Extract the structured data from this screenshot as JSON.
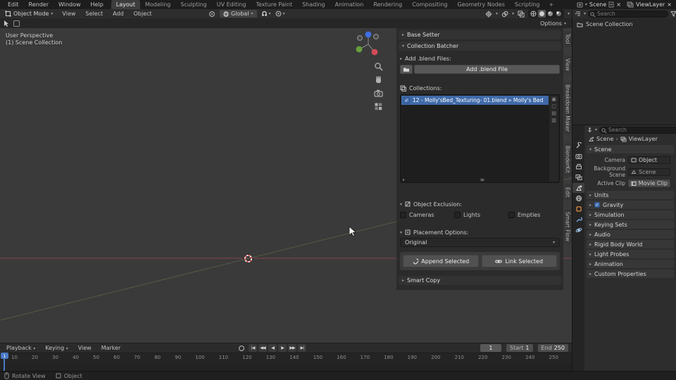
{
  "topbar": {
    "menus": [
      "Edit",
      "Render",
      "Window",
      "Help"
    ],
    "tabs": [
      "Layout",
      "Modeling",
      "Sculpting",
      "UV Editing",
      "Texture Paint",
      "Shading",
      "Animation",
      "Rendering",
      "Compositing",
      "Geometry Nodes",
      "Scripting"
    ],
    "add_tab": "+",
    "scene": "Scene",
    "viewlayer": "ViewLayer"
  },
  "header": {
    "mode": "Object Mode",
    "menus": [
      "View",
      "Select",
      "Add",
      "Object"
    ],
    "orientation": "Global",
    "options": "Options"
  },
  "viewport": {
    "perspective_label": "User Perspective",
    "collection_label": "(1) Scene Collection"
  },
  "sidebar_tabs": [
    "Tool",
    "View",
    "Breakdown Maker",
    "BlenderKit",
    "Edit",
    "Smart Flow"
  ],
  "npanel": {
    "base_setter": "Base Setter",
    "collection_batcher": "Collection Batcher",
    "add_blend_files_label": "Add .blend Files:",
    "add_blend_file_button": "Add .blend File",
    "collections_label": "Collections:",
    "collection_item": "12 - Molly'sBed_Texturing- 01.blend » Molly's Bed",
    "object_exclusion_label": "Object Exclusion:",
    "exclusion_options": [
      "Cameras",
      "Lights",
      "Empties"
    ],
    "placement_label": "Placement Options:",
    "placement_value": "Original",
    "append_button": "Append Selected",
    "link_button": "Link Selected",
    "smart_copy": "Smart Copy"
  },
  "outliner": {
    "search_placeholder": "Search",
    "root_item": "Scene Collection"
  },
  "properties": {
    "search_placeholder": "Search",
    "breadcrumb": {
      "scene": "Scene",
      "viewlayer": "ViewLayer"
    },
    "scene_section": "Scene",
    "fields": [
      {
        "label": "Camera",
        "value": "Object"
      },
      {
        "label": "Background Scene",
        "value": "Scene"
      },
      {
        "label": "Active Clip",
        "value": "Movie Clip"
      }
    ],
    "sections": [
      "Units",
      "Gravity",
      "Simulation",
      "Keying Sets",
      "Audio",
      "Rigid Body World",
      "Light Probes",
      "Animation",
      "Custom Properties"
    ]
  },
  "timeline": {
    "menus": [
      "Playback",
      "Keying",
      "View",
      "Marker"
    ],
    "current_frame": "1",
    "start_label": "Start",
    "start_value": "1",
    "end_label": "End",
    "end_value": "250",
    "ticks": [
      "10",
      "20",
      "30",
      "40",
      "50",
      "60",
      "70",
      "80",
      "90",
      "100",
      "110",
      "120",
      "130",
      "140",
      "150",
      "160",
      "170",
      "180",
      "190",
      "200",
      "210",
      "220",
      "230",
      "240",
      "250"
    ]
  },
  "statusbar": {
    "left": "Rotate View",
    "right": "Object"
  },
  "icons": {
    "caret_down": "▾",
    "caret_right": "▸",
    "check": "✓",
    "close": "×",
    "breadcrumb_sep": "›",
    "grip": "≡",
    "playback": [
      "|◀",
      "◀◀",
      "◀",
      "▶",
      "▶▶",
      "▶|"
    ],
    "list_buttons": [
      "▣",
      "▢",
      "▤",
      "▥"
    ]
  },
  "colors": {
    "selection_blue": "#4772b3",
    "axis_red": "#9a4455",
    "axis_green": "#6b7d4f",
    "object_orange": "#dd8d3f"
  }
}
